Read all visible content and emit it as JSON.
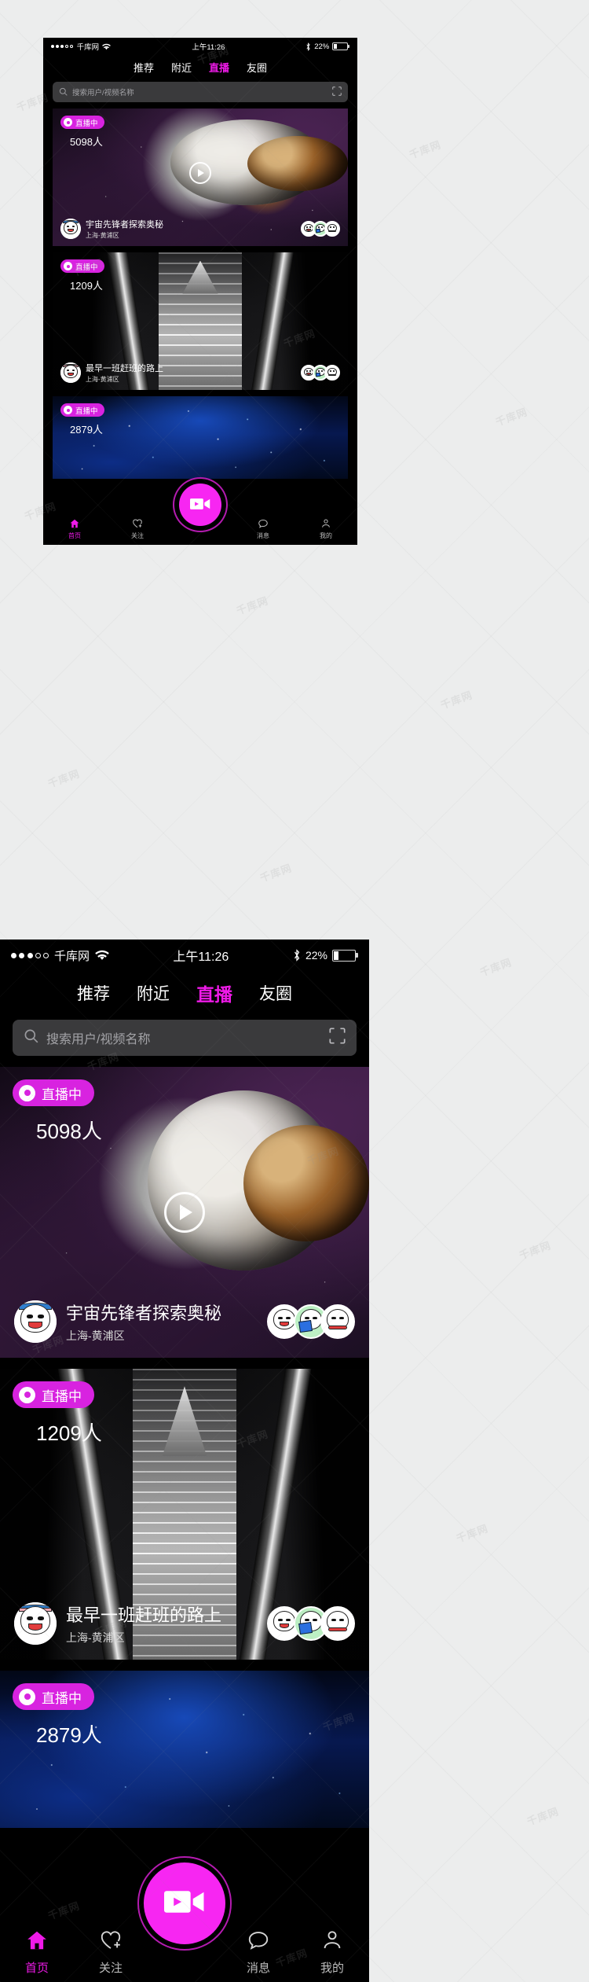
{
  "app": {
    "accent": "#ef1ae8",
    "badge_color": "#d823e0",
    "fab_color": "#f726f2",
    "bg": "#000000"
  },
  "status_bar": {
    "signal_dots_filled": 3,
    "signal_dots_total": 5,
    "carrier": "千库网",
    "wifi_icon": "wifi-icon",
    "time": "上午11:26",
    "bluetooth_icon": "bluetooth-icon",
    "battery_percent": "22%",
    "battery_level": 22
  },
  "tabs": [
    {
      "label": "推荐",
      "active": false
    },
    {
      "label": "附近",
      "active": false
    },
    {
      "label": "直播",
      "active": true
    },
    {
      "label": "友圈",
      "active": false
    }
  ],
  "search": {
    "icon": "search-icon",
    "placeholder": "搜索用户/视频名称",
    "value": "",
    "scan_icon": "scan-code-icon"
  },
  "live_badge_label": "直播中",
  "cards": [
    {
      "badge": "直播中",
      "viewers": "5098人",
      "title": "宇宙先锋者探索奥秘",
      "location": "上海-黄浦区",
      "has_play_button": true,
      "play_icon": "play-icon",
      "avatar": "avatar-cosmic-host",
      "background": "space-moon-planet",
      "watchers": [
        "watcher-avatar-1",
        "watcher-avatar-2",
        "watcher-avatar-3"
      ]
    },
    {
      "badge": "直播中",
      "viewers": "1209人",
      "title": "最早一班赶班的路上",
      "location": "上海-黄浦区",
      "has_play_button": false,
      "play_icon": "",
      "avatar": "avatar-commuter-host",
      "background": "escalator",
      "watchers": [
        "watcher-avatar-1",
        "watcher-avatar-2",
        "watcher-avatar-3"
      ]
    },
    {
      "badge": "直播中",
      "viewers": "2879人",
      "title": "",
      "location": "",
      "has_play_button": false,
      "play_icon": "",
      "avatar": "",
      "background": "starfield",
      "watchers": []
    }
  ],
  "bottom_nav": {
    "items": [
      {
        "label": "首页",
        "icon": "home-icon",
        "active": true
      },
      {
        "label": "关注",
        "icon": "heart-plus-icon",
        "active": false
      },
      {
        "label": "消息",
        "icon": "chat-bubble-icon",
        "active": false
      },
      {
        "label": "我的",
        "icon": "person-icon",
        "active": false
      }
    ],
    "fab": {
      "icon": "video-camera-icon",
      "label": ""
    }
  },
  "watermark": {
    "text": "千库网",
    "mark": "IC"
  }
}
